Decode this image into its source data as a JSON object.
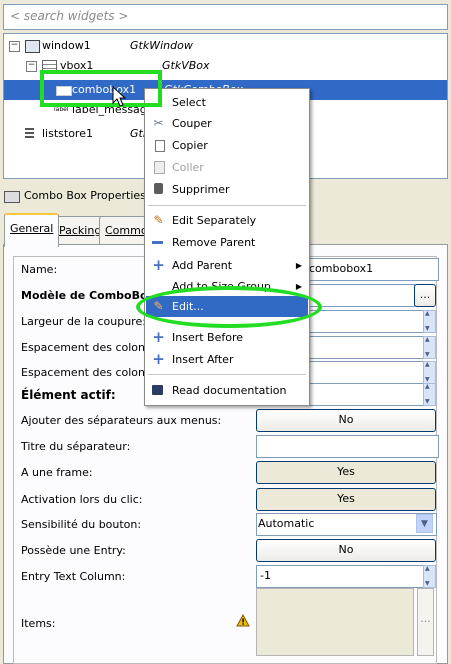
{
  "search": {
    "placeholder": "< search widgets >"
  },
  "tree": {
    "rows": [
      {
        "name": "window1",
        "type": "GtkWindow"
      },
      {
        "name": "vbox1",
        "type": "GtkVBox"
      },
      {
        "name": "combobox1",
        "type": "GtkComboBox"
      },
      {
        "name": "label_message",
        "type": ""
      },
      {
        "name": "liststore1",
        "type": "GtkListStore"
      }
    ]
  },
  "properties": {
    "header": "Combo Box Properties - combobox1",
    "tabs": [
      "General",
      "Packing",
      "Common"
    ],
    "rows": [
      {
        "label": "Name:",
        "value": "combobox1"
      },
      {
        "label": "Modèle de ComboBox:",
        "value": ""
      },
      {
        "label": "Largeur de la coupure:",
        "value": ""
      },
      {
        "label": "Espacement des colonnes:",
        "value": ""
      },
      {
        "label": "Espacement des colonnes:",
        "value": ""
      },
      {
        "label": "Élément actif:",
        "value": ""
      },
      {
        "label": "Ajouter des séparateurs aux menus:",
        "value": "No"
      },
      {
        "label": "Titre du séparateur:",
        "value": ""
      },
      {
        "label": "A une frame:",
        "value": "Yes"
      },
      {
        "label": "Activation lors du clic:",
        "value": "Yes"
      },
      {
        "label": "Sensibilité du bouton:",
        "value": "Automatic"
      },
      {
        "label": "Possède une Entry:",
        "value": "No"
      },
      {
        "label": "Entry Text Column:",
        "value": "-1"
      },
      {
        "label": "Items:",
        "value": ""
      }
    ],
    "ellipsis": "..."
  },
  "menu": {
    "items": [
      {
        "label": "Select",
        "icon": "select-icon"
      },
      {
        "label": "Couper",
        "icon": "scissors-icon"
      },
      {
        "label": "Copier",
        "icon": "copy-icon"
      },
      {
        "label": "Coller",
        "icon": "paste-icon",
        "disabled": true
      },
      {
        "label": "Supprimer",
        "icon": "trash-icon"
      },
      {
        "label": "Edit Separately",
        "icon": "edit-icon"
      },
      {
        "label": "Remove Parent",
        "icon": "minus-icon"
      },
      {
        "label": "Add Parent",
        "icon": "plus-icon"
      },
      {
        "label": "Add to Size Group",
        "icon": "group-icon"
      },
      {
        "label": "Edit...",
        "icon": "edit-icon",
        "highlighted": true
      },
      {
        "label": "Insert Before",
        "icon": "plus-icon"
      },
      {
        "label": "Insert After",
        "icon": "plus-icon"
      },
      {
        "label": "Read documentation",
        "icon": "book-icon"
      }
    ]
  },
  "colors": {
    "selection": "#3169c6",
    "highlight": "#22dd22"
  }
}
